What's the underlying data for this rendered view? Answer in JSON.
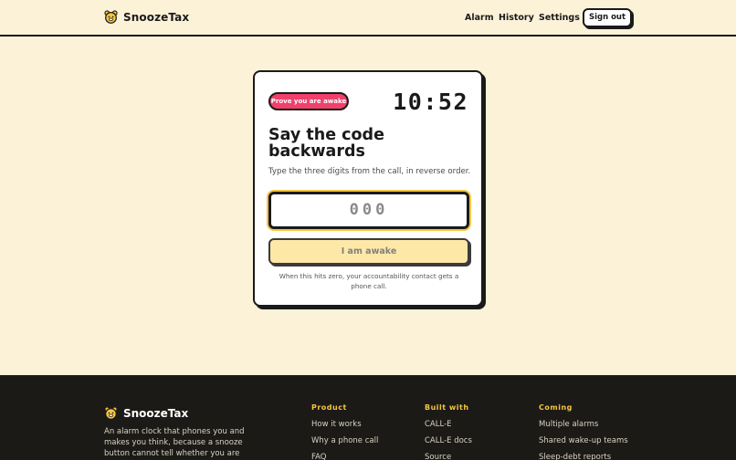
{
  "header": {
    "brand": "SnoozeTax",
    "brand_icon": "bear-icon",
    "nav": [
      "Alarm",
      "History",
      "Settings"
    ],
    "sign_out": "Sign out"
  },
  "card": {
    "badge": "Prove you are awake",
    "timer": "10:52",
    "title": "Say the code backwards",
    "subtitle": "Type the three digits from the call, in reverse order.",
    "input_placeholder": "000",
    "input_value": "",
    "submit": "I am awake",
    "note": "When this hits zero, your accountability contact gets a phone call."
  },
  "footer": {
    "brand": "SnoozeTax",
    "description": "An alarm clock that phones you and makes you think, because a snooze button cannot tell whether you are awake.",
    "columns": [
      {
        "heading": "Product",
        "items": [
          "How it works",
          "Why a phone call",
          "FAQ"
        ]
      },
      {
        "heading": "Built with",
        "items": [
          "CALL-E",
          "CALL-E docs",
          "Source"
        ]
      },
      {
        "heading": "Coming",
        "items": [
          "Multiple alarms",
          "Shared wake-up teams",
          "Sleep-debt reports"
        ]
      }
    ]
  },
  "colors": {
    "background": "#fcf2d8",
    "accent_yellow": "#f5c542",
    "badge_pink": "#f0406c",
    "footer_bg": "#1c1a17"
  }
}
